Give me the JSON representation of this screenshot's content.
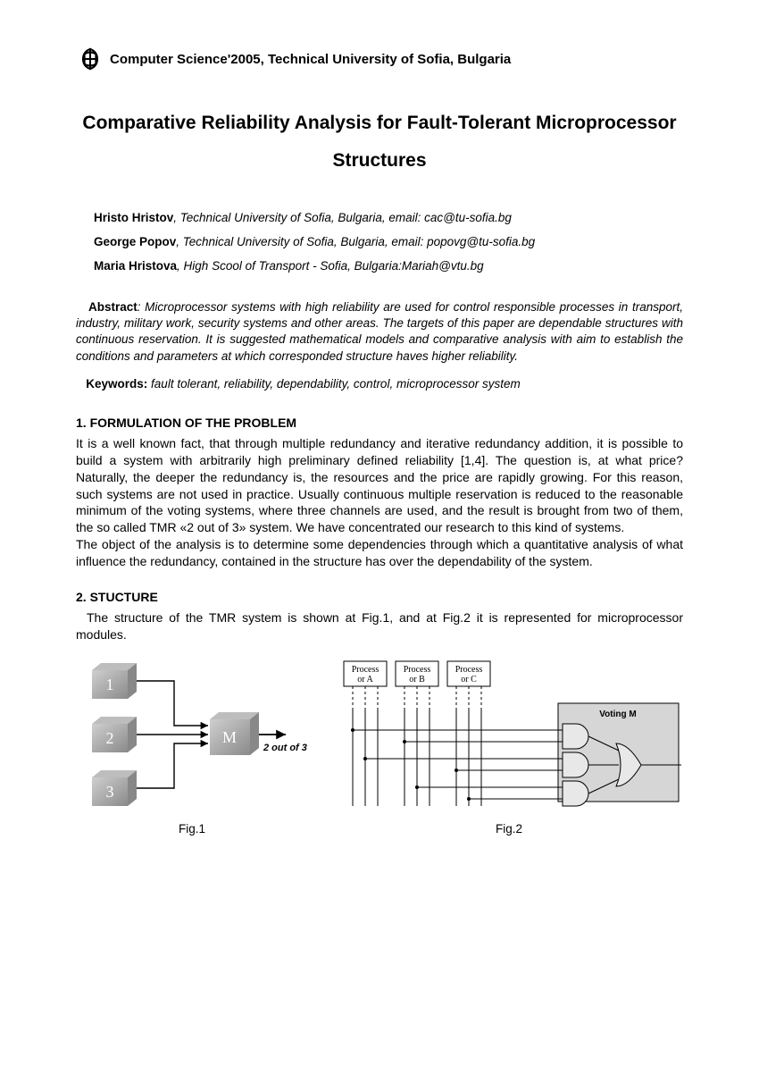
{
  "conference": "Computer Science'2005, Technical University of Sofia, Bulgaria",
  "title": "Comparative Reliability Analysis for Fault-Tolerant Microprocessor Structures",
  "authors": [
    {
      "name": "Hristo Hristov",
      "detail": ", Technical University of Sofia, Bulgaria, email: cac@tu-sofia.bg"
    },
    {
      "name": "George Popov",
      "detail": ", Technical University of Sofia, Bulgaria, email: popovg@tu-sofia.bg"
    },
    {
      "name": "Maria Hristova",
      "detail": ", High Scool of Transport - Sofia, Bulgaria:Mariah@vtu.bg"
    }
  ],
  "abstract": {
    "label": "Abstract",
    "text": ": Microprocessor systems with high reliability are used for control responsible processes in transport, industry, military work, security systems and other areas. The targets of this paper are dependable structures with continuous reservation. It is suggested mathematical models and comparative analysis with aim to establish the conditions and parameters at which corresponded structure haves higher reliability."
  },
  "keywords": {
    "label": "Keywords:",
    "text": " fault tolerant, reliability, dependability, control, microprocessor system"
  },
  "section1": {
    "heading": "1. FORMULATION OF THE PROBLEM",
    "p1": "It is a well known fact, that through multiple redundancy and iterative redundancy addition, it is possible to build a system with  arbitrarily high preliminary defined reliability [1,4]. The question is, at what price? Naturally, the deeper the redundancy is, the resources and the price are rapidly growing. For this reason, such systems are not used in practice.  Usually continuous multiple reservation is reduced to the reasonable minimum of the voting systems, where three channels are used, and the result is brought from two of them, the so called TMR «2 out of 3» system. We have concentrated our research to this kind of systems.",
    "p2": "The object of the analysis is to determine some dependencies through which a quantitative analysis of what influence the redundancy, contained in the structure has over the dependability of the system."
  },
  "section2": {
    "heading": "2. STUCTURE",
    "p1": "The structure of the TMR system is shown at Fig.1, and at Fig.2 it is represented for microprocessor modules."
  },
  "fig1": {
    "label": "Fig.1",
    "block1": "1",
    "block2": "2",
    "block3": "3",
    "blockM": "M",
    "caption": "2 out of 3"
  },
  "fig2": {
    "label": "Fig.2",
    "procA": "Process or A",
    "procB": "Process or B",
    "procC": "Process or C",
    "voting": "Voting M"
  }
}
